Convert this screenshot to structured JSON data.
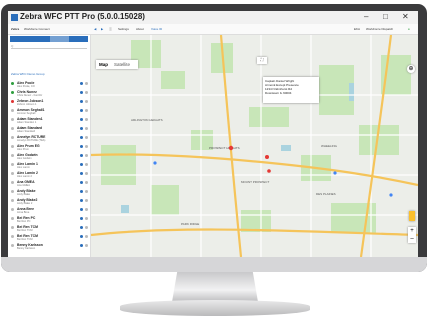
{
  "app": {
    "title": "Zebra WFC PTT Pro (5.0.0.15028)",
    "minimize": "–",
    "maximize": "□",
    "close": "✕"
  },
  "toolbar": {
    "brand": "Zebra",
    "org": "Workforce Connect",
    "items": [
      "Settings",
      "About",
      "Voice ID"
    ],
    "right_items": [
      "EKA",
      "WorkForce Dispatch"
    ]
  },
  "sidebar": {
    "search_placeholder": "Q",
    "group_header": "Zebra WFC Demo Group",
    "contacts": [
      {
        "name": "Alex Poole",
        "sub": "Alex Poole, CO",
        "status": "#2e9e3e"
      },
      {
        "name": "Chris Nunez",
        "sub": "Chris Nunez - Fun/Ctr",
        "status": "#2e9e3e"
      },
      {
        "name": "Zebron Jobson1",
        "sub": "Zebron Jobson 1",
        "status": "#d33"
      },
      {
        "name": "Ammon Seghall1",
        "sub": "Ammon Seghall",
        "status": "#bbb"
      },
      {
        "name": "Adam Standen1",
        "sub": "Adam Standen 1",
        "status": "#bbb"
      },
      {
        "name": "Adam Standard",
        "sub": "Adam Standard",
        "status": "#bbb"
      },
      {
        "name": "Annelyn RCTURE",
        "sub": "Annelyn RCTURE (TEA)",
        "status": "#bbb"
      },
      {
        "name": "Alex Prum EG",
        "sub": "Alex Prum",
        "status": "#bbb"
      },
      {
        "name": "Alex Godwin",
        "sub": "Alex Godwin",
        "status": "#bbb"
      },
      {
        "name": "Alex Lamin 1",
        "sub": "Alex Lamin",
        "status": "#bbb"
      },
      {
        "name": "Alex Lamin 2",
        "sub": "Alex Lamin 2",
        "status": "#bbb"
      },
      {
        "name": "Ana GMEA",
        "sub": "Ana GMEA",
        "status": "#bbb"
      },
      {
        "name": "Andy Blake",
        "sub": "Andy Blake",
        "status": "#bbb"
      },
      {
        "name": "Andy Blake2",
        "sub": "Andy Blake 2",
        "status": "#bbb"
      },
      {
        "name": "Anna Bree",
        "sub": "Anna Bree",
        "status": "#bbb"
      },
      {
        "name": "Bei Ren PC",
        "sub": "Bei Ren PC",
        "status": "#bbb"
      },
      {
        "name": "Bei Ren TCM",
        "sub": "Bei Ren TCM",
        "status": "#bbb"
      },
      {
        "name": "Bei Ren TCM",
        "sub": "Bei Ren TCM",
        "status": "#bbb"
      },
      {
        "name": "Benny Karlsson",
        "sub": "Benny Karlsson",
        "status": "#bbb"
      }
    ]
  },
  "map": {
    "tabs": [
      "Map",
      "Satellite"
    ],
    "active_tab": "Map",
    "callout_lines": [
      "Captain Daniel Wright",
      "Armonk Except Presence",
      "1234 N Elmhurst Rd",
      "Downtown IL 60004"
    ],
    "zoom_in": "+",
    "zoom_out": "–",
    "cities": [
      "Prospect Heights",
      "Wheeling",
      "Arlington Heights",
      "Mount Prospect",
      "Des Plaines",
      "Park Ridge",
      "Niles",
      "Rolling Meadows",
      "Palatine"
    ]
  },
  "colors": {
    "accent": "#2a6ebb",
    "park": "#c8e6b8",
    "water": "#aad3df",
    "highway": "#f5c45a"
  }
}
